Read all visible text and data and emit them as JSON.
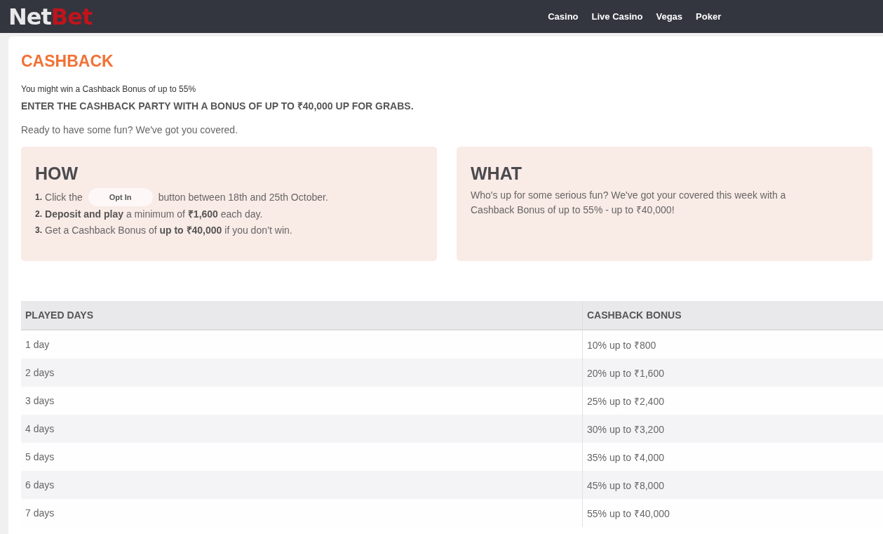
{
  "header": {
    "logo": {
      "first": "Net",
      "second": "Bet"
    },
    "nav": [
      "Casino",
      "Live Casino",
      "Vegas",
      "Poker"
    ]
  },
  "promo": {
    "title": "CASHBACK",
    "subtitle": "You might win a Cashback Bonus of up to 55%",
    "headline": "ENTER THE CASHBACK PARTY WITH A BONUS OF UP TO ₹40,000 UP FOR GRABS.",
    "intro": "Ready to have some fun? We've got you covered."
  },
  "how": {
    "title": "HOW",
    "steps": [
      {
        "number": "1.",
        "kind": "button",
        "before": "Click the",
        "button": "Opt In",
        "after": "button between 18th and 25th October."
      },
      {
        "number": "2.",
        "kind": "text",
        "text": "**Deposit and play** a minimum of **₹1,600** each day."
      },
      {
        "number": "3.",
        "kind": "text",
        "text": "Get a Cashback Bonus of **up to ₹40,000** if you don’t win."
      }
    ]
  },
  "what": {
    "title": "WHAT",
    "text": "Who's up for some serious fun? We've got your covered this week with a Cashback Bonus of up to 55% - up to ₹40,000!"
  },
  "table": {
    "columns": [
      "PLAYED DAYS",
      "CASHBACK BONUS"
    ],
    "rows": [
      [
        "1 day",
        "10% up to ₹800"
      ],
      [
        "2 days",
        "20% up to ₹1,600"
      ],
      [
        "3 days",
        "25% up to ₹2,400"
      ],
      [
        "4 days",
        "30% up to ₹3,200"
      ],
      [
        "5 days",
        "35% up to ₹4,000"
      ],
      [
        "6 days",
        "45% up to ₹8,000"
      ],
      [
        "7 days",
        "55% up to ₹40,000"
      ]
    ]
  }
}
